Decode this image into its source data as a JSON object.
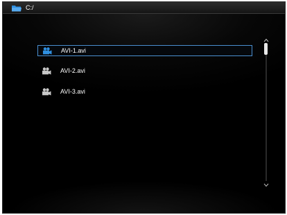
{
  "title_bar": {
    "path": "C:/",
    "icon": "folder-icon",
    "icon_color": "#2f8fe0"
  },
  "files": [
    {
      "name": "AVI-1.avi",
      "icon": "video-camera-icon",
      "selected": true
    },
    {
      "name": "AVI-2.avi",
      "icon": "video-camera-icon",
      "selected": false
    },
    {
      "name": "AVI-3.avi",
      "icon": "video-camera-icon",
      "selected": false
    }
  ],
  "colors": {
    "selected_border": "#4a8fd0",
    "selected_icon": "#2f8fe0",
    "unselected_icon": "#c8c8c8",
    "text": "#ffffff"
  },
  "scrollbar": {
    "position": 0
  }
}
